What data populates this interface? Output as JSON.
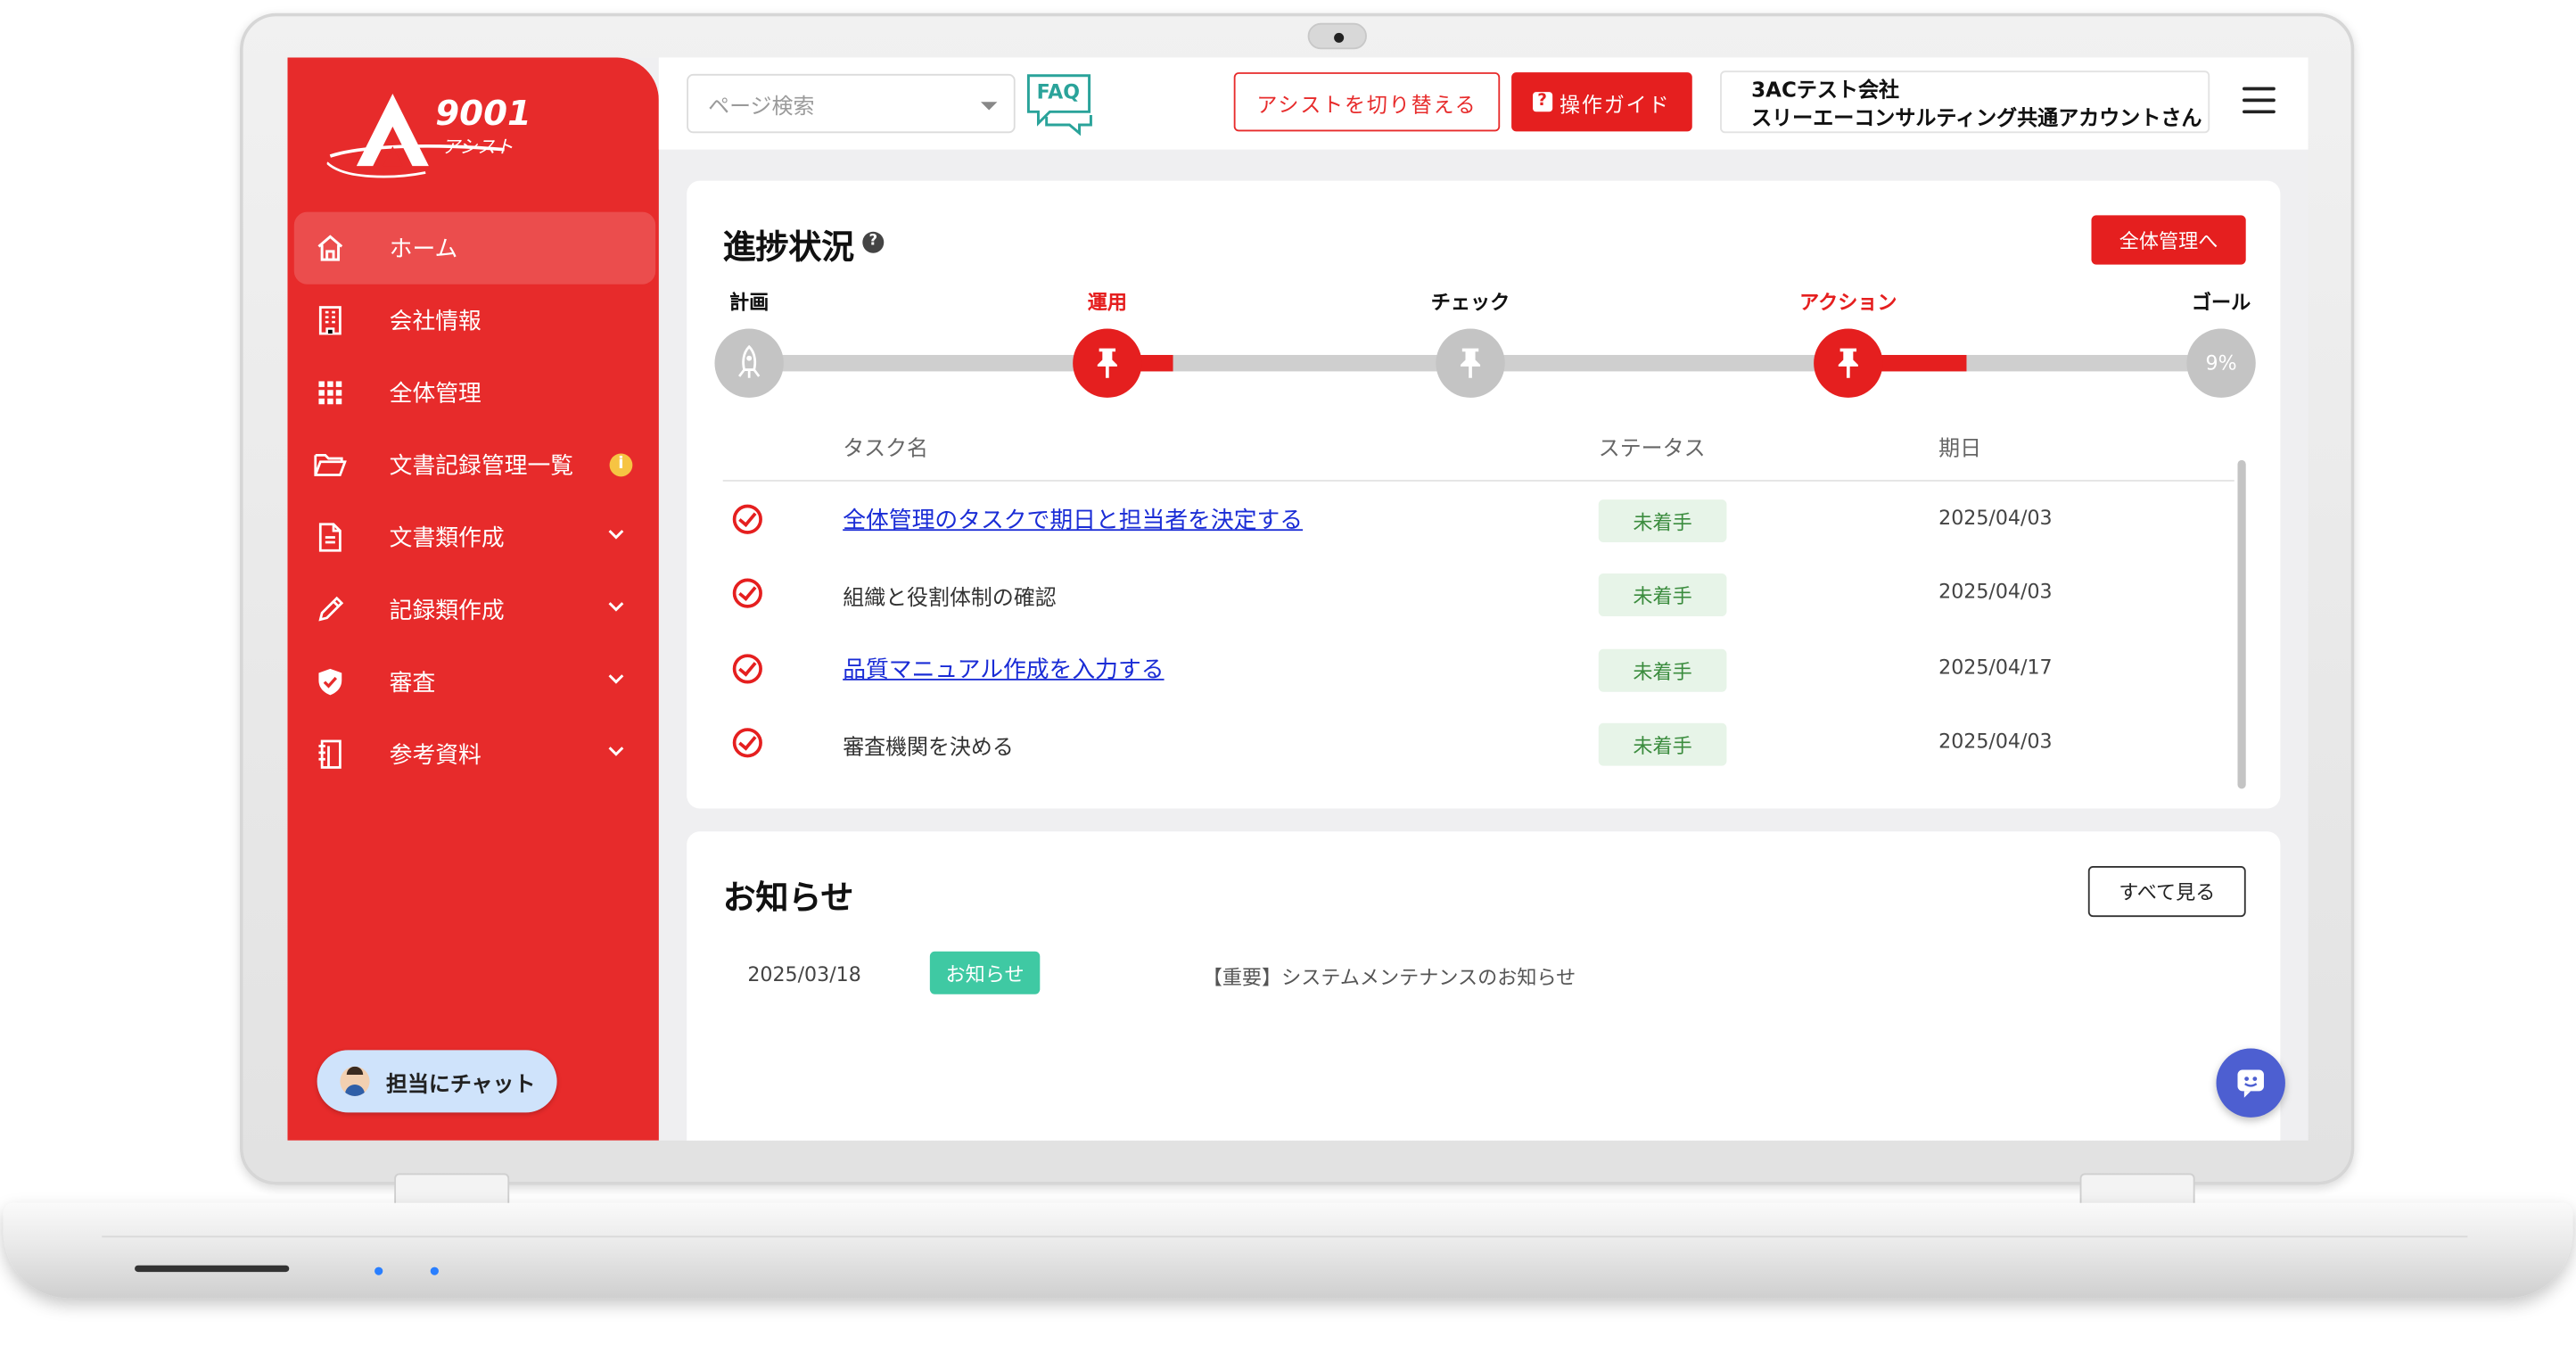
{
  "logo": {
    "number": "9001",
    "subtitle": "アシスト"
  },
  "sidebar": {
    "items": [
      {
        "label": "ホーム",
        "icon": "home-icon",
        "active": true
      },
      {
        "label": "会社情報",
        "icon": "building-icon"
      },
      {
        "label": "全体管理",
        "icon": "grid-icon"
      },
      {
        "label": "文書記録管理一覧",
        "icon": "folder-icon",
        "badge": "i"
      },
      {
        "label": "文書類作成",
        "icon": "document-icon",
        "expandable": true
      },
      {
        "label": "記録類作成",
        "icon": "pencil-icon",
        "expandable": true
      },
      {
        "label": "審査",
        "icon": "shield-check-icon",
        "expandable": true
      },
      {
        "label": "参考資料",
        "icon": "notebook-icon",
        "expandable": true
      }
    ],
    "chat_button": "担当にチャット"
  },
  "header": {
    "search_placeholder": "ページ検索",
    "faq_label": "FAQ",
    "switch_button": "アシストを切り替える",
    "guide_icon": "?",
    "guide_button": "操作ガイド",
    "account_company": "3ACテスト会社",
    "account_user": "スリーエーコンサルティング共通アカウントさん"
  },
  "progress": {
    "title": "進捗状況",
    "help": "?",
    "overall_button": "全体管理へ",
    "stages": [
      {
        "label": "計画",
        "state": "done"
      },
      {
        "label": "運用",
        "state": "current"
      },
      {
        "label": "チェック",
        "state": "pending"
      },
      {
        "label": "アクション",
        "state": "current"
      },
      {
        "label": "ゴール",
        "state": "goal",
        "value": "9%"
      }
    ],
    "columns": {
      "task": "タスク名",
      "status": "ステータス",
      "due": "期日"
    },
    "tasks": [
      {
        "name": "全体管理のタスクで期日と担当者を決定する",
        "link": true,
        "status": "未着手",
        "due": "2025/04/03"
      },
      {
        "name": "組織と役割体制の確認",
        "link": false,
        "status": "未着手",
        "due": "2025/04/03"
      },
      {
        "name": "品質マニュアル作成を入力する",
        "link": true,
        "status": "未着手",
        "due": "2025/04/17"
      },
      {
        "name": "審査機関を決める",
        "link": false,
        "status": "未着手",
        "due": "2025/04/03"
      }
    ]
  },
  "news": {
    "title": "お知らせ",
    "see_all_button": "すべて見る",
    "items": [
      {
        "date": "2025/03/18",
        "badge": "お知らせ",
        "text": "【重要】システムメンテナンスのお知らせ"
      }
    ]
  },
  "colors": {
    "brand_red": "#e72b2b",
    "status_green": "#3b8c3e",
    "link_blue": "#1a2cd6",
    "badge_teal": "#3fc9a3"
  }
}
